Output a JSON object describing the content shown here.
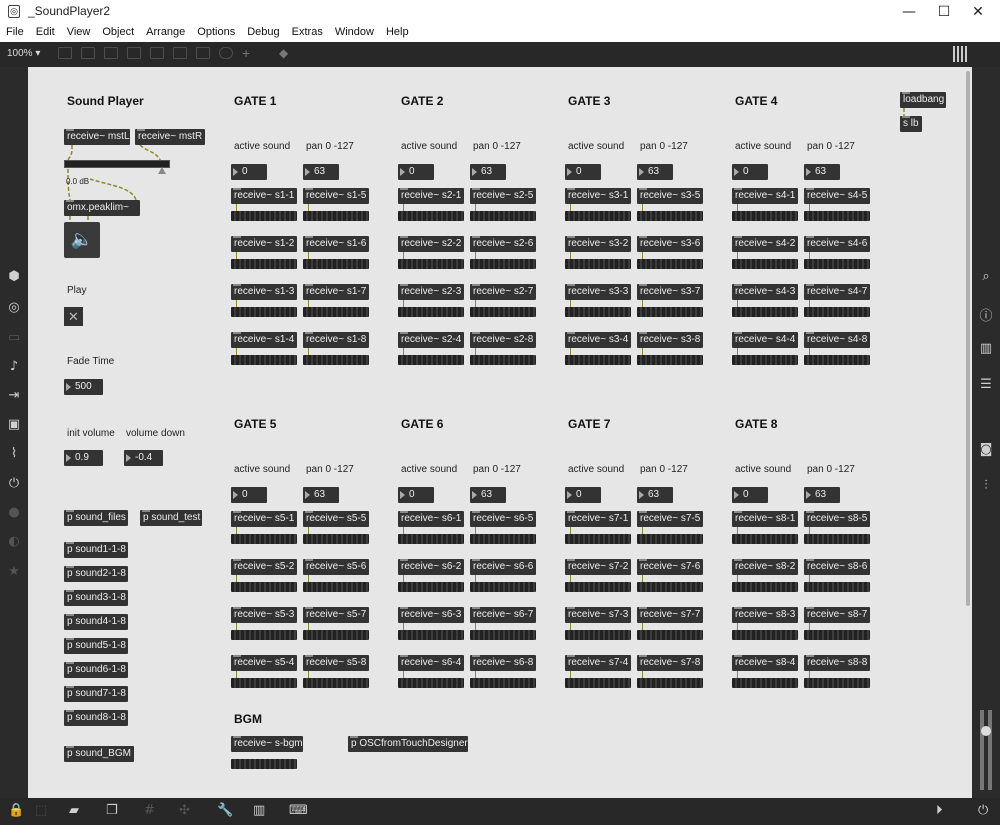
{
  "window": {
    "title": "_SoundPlayer2",
    "minimize": "—",
    "maximize": "☐",
    "close": "✕"
  },
  "menu": [
    "File",
    "Edit",
    "View",
    "Object",
    "Arrange",
    "Options",
    "Debug",
    "Extras",
    "Window",
    "Help"
  ],
  "toolbar": {
    "zoom": "100% ▾"
  },
  "player": {
    "title": "Sound Player",
    "receive_l": "receive~ mstL",
    "receive_r": "receive~ mstR",
    "gain_label": "0.0 dB",
    "peaklim": "omx.peaklim~",
    "play_label": "Play",
    "fade_label": "Fade Time",
    "fade_value": "500",
    "init_volume_label": "init volume",
    "volume_down_label": "volume down",
    "init_volume_value": "0.9",
    "volume_down_value": "-0.4"
  },
  "subpatches": {
    "sound_files": "p sound_files",
    "sound_test": "p sound_test",
    "sounds": [
      "p sound1-1-8",
      "p sound2-1-8",
      "p sound3-1-8",
      "p sound4-1-8",
      "p sound5-1-8",
      "p sound6-1-8",
      "p sound7-1-8",
      "p sound8-1-8"
    ],
    "sound_bgm": "p sound_BGM"
  },
  "gate_labels": {
    "active": "active sound",
    "pan": "pan 0 -127",
    "active_value": "0",
    "pan_value": "63"
  },
  "gates": [
    {
      "name": "GATE 1",
      "receives": [
        "receive~ s1-1",
        "receive~ s1-2",
        "receive~ s1-3",
        "receive~ s1-4",
        "receive~ s1-5",
        "receive~ s1-6",
        "receive~ s1-7",
        "receive~ s1-8"
      ]
    },
    {
      "name": "GATE 2",
      "receives": [
        "receive~ s2-1",
        "receive~ s2-2",
        "receive~ s2-3",
        "receive~ s2-4",
        "receive~ s2-5",
        "receive~ s2-6",
        "receive~ s2-7",
        "receive~ s2-8"
      ]
    },
    {
      "name": "GATE 3",
      "receives": [
        "receive~ s3-1",
        "receive~ s3-2",
        "receive~ s3-3",
        "receive~ s3-4",
        "receive~ s3-5",
        "receive~ s3-6",
        "receive~ s3-7",
        "receive~ s3-8"
      ]
    },
    {
      "name": "GATE 4",
      "receives": [
        "receive~ s4-1",
        "receive~ s4-2",
        "receive~ s4-3",
        "receive~ s4-4",
        "receive~ s4-5",
        "receive~ s4-6",
        "receive~ s4-7",
        "receive~ s4-8"
      ]
    },
    {
      "name": "GATE 5",
      "receives": [
        "receive~ s5-1",
        "receive~ s5-2",
        "receive~ s5-3",
        "receive~ s5-4",
        "receive~ s5-5",
        "receive~ s5-6",
        "receive~ s5-7",
        "receive~ s5-8"
      ]
    },
    {
      "name": "GATE 6",
      "receives": [
        "receive~ s6-1",
        "receive~ s6-2",
        "receive~ s6-3",
        "receive~ s6-4",
        "receive~ s6-5",
        "receive~ s6-6",
        "receive~ s6-7",
        "receive~ s6-8"
      ]
    },
    {
      "name": "GATE 7",
      "receives": [
        "receive~ s7-1",
        "receive~ s7-2",
        "receive~ s7-3",
        "receive~ s7-4",
        "receive~ s7-5",
        "receive~ s7-6",
        "receive~ s7-7",
        "receive~ s7-8"
      ]
    },
    {
      "name": "GATE 8",
      "receives": [
        "receive~ s8-1",
        "receive~ s8-2",
        "receive~ s8-3",
        "receive~ s8-4",
        "receive~ s8-5",
        "receive~ s8-6",
        "receive~ s8-7",
        "receive~ s8-8"
      ]
    }
  ],
  "bgm": {
    "title": "BGM",
    "receive": "receive~ s-bgm",
    "osc": "p OSCfromTouchDesigner"
  },
  "loadbang": {
    "loadbang": "loadbang",
    "send": "s lb"
  },
  "icons": {
    "left": [
      "package-icon",
      "target-icon",
      "presentation-icon",
      "music-note-icon",
      "step-icon",
      "image-icon",
      "clip-icon",
      "plug-icon",
      "record-icon",
      "snapshot-icon",
      "star-icon"
    ],
    "right": [
      "search-icon",
      "info-icon",
      "book-icon",
      "list-icon",
      "camera-icon",
      "mixer-icon"
    ],
    "bottom": [
      "lock-icon",
      "edit-mode-icon",
      "comment-icon",
      "windows-icon",
      "grid-icon",
      "patch-cord-icon",
      "wrench-icon",
      "keyboard-icon",
      "qwerty-icon",
      "play-icon",
      "power-icon"
    ]
  },
  "colors": {
    "canvas": "#e6e6e6",
    "object": "#333333",
    "chrome": "#282828",
    "cord": "#8a8a2a"
  }
}
